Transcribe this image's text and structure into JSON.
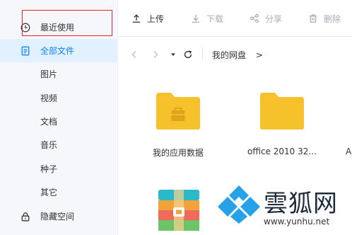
{
  "sidebar": {
    "items": [
      {
        "label": "最近使用",
        "icon": "clock-icon"
      },
      {
        "label": "全部文件",
        "icon": "document-icon"
      },
      {
        "label": "图片"
      },
      {
        "label": "视频"
      },
      {
        "label": "文档"
      },
      {
        "label": "音乐"
      },
      {
        "label": "种子"
      },
      {
        "label": "其它"
      },
      {
        "label": "隐藏空间",
        "icon": "lock-icon"
      }
    ]
  },
  "toolbar": {
    "upload": "上传",
    "download": "下载",
    "share": "分享",
    "delete": "删除"
  },
  "nav": {
    "breadcrumb": "我的网盘",
    "breadcrumb_sep": ">"
  },
  "files": [
    {
      "name": "我的应用数据",
      "icon": "app-folder-icon"
    },
    {
      "name": "office 2010 32...",
      "icon": "folder-icon"
    },
    {
      "name": "A",
      "icon": "folder-icon"
    }
  ],
  "watermark": {
    "brand": "雲狐网",
    "url": "www.yunhu.net"
  },
  "colors": {
    "accent": "#0a84ff",
    "folder": "#f8c12d",
    "highlight": "#e0232f"
  }
}
